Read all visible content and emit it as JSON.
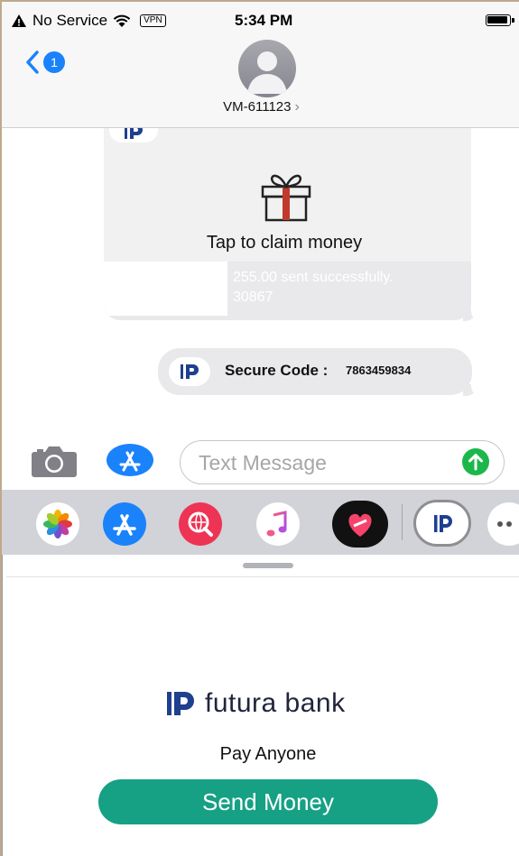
{
  "status_bar": {
    "carrier": "No Service",
    "vpn": "VPN",
    "time": "5:34 PM"
  },
  "header": {
    "back_badge": "1",
    "contact": "VM-611123",
    "chevron": "›"
  },
  "messages": {
    "card": {
      "claim_text": "Tap to claim money",
      "ghost_line_1": "255.00 sent successfully.",
      "ghost_line_2": "30867"
    },
    "secure": {
      "label": "Secure Code :",
      "code": "7863459834"
    }
  },
  "composer": {
    "placeholder": "Text Message"
  },
  "app_drawer": {
    "icons": [
      "photos-icon",
      "app-store-icon",
      "web-search-icon",
      "music-icon",
      "heart-stickers-icon",
      "futura-bank-app-icon",
      "more-icon"
    ]
  },
  "sheet": {
    "bank_name": "futura bank",
    "pay_anyone": "Pay Anyone",
    "send_money": "Send Money"
  },
  "colors": {
    "ios_blue": "#1a82fb",
    "send_green": "#1cb74a",
    "bank_teal": "#16a084",
    "bubble_gray": "#e9e9eb"
  }
}
